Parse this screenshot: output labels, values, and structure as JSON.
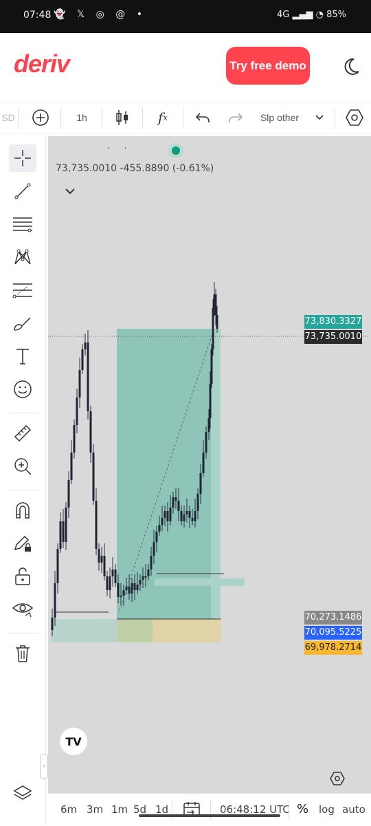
{
  "status_bar": {
    "time": "07:48",
    "left_icons": "snapchat x whatsapp threads •",
    "network": "4G",
    "battery": "85%"
  },
  "header": {
    "logo": "deriv",
    "demo_button": "Try free demo",
    "theme_icon": "moon-icon"
  },
  "toolbar": {
    "symbol_fragment": "SD",
    "add_icon": "plus-circle-icon",
    "interval": "1h",
    "chart_type_icon": "candlestick-icon",
    "indicators_icon": "fx-icon",
    "undo_icon": "undo-icon",
    "redo_icon": "redo-icon",
    "template_label": "Slp other",
    "settings_icon": "hexagon-settings-icon"
  },
  "tools": [
    "crosshair-icon",
    "trend-line-icon",
    "fib-lines-icon",
    "pattern-icon",
    "forecast-icon",
    "brush-icon",
    "text-icon",
    "emoji-icon",
    "ruler-icon",
    "zoom-in-icon",
    "magnet-icon",
    "pencil-lock-icon",
    "unlock-icon",
    "eye-icon",
    "trash-icon",
    "layers-icon"
  ],
  "chart": {
    "ohlc_readout": "73,735.0010  -455.8890 (-0.61%)",
    "price_labels": {
      "target": "73,830.3327",
      "current": "73,735.0010",
      "gray": "70,273.1486",
      "blue": "70,095.5225",
      "yellow": "69,978.2714"
    },
    "colors": {
      "target": "#26a69a",
      "current": "#2b2b2b",
      "gray": "#888888",
      "blue": "#2962ff",
      "yellow": "#f7b731",
      "profit_zone": "#8ec5b8",
      "loss_zone": "#e0d3a8"
    },
    "watermark": "TV"
  },
  "bottom_bar": {
    "ranges": [
      "6m",
      "3m",
      "1m",
      "5d",
      "1d"
    ],
    "goto_icon": "calendar-arrow-icon",
    "clock": "06:48:12 UTC",
    "percent": "%",
    "log": "log",
    "auto": "auto"
  }
}
